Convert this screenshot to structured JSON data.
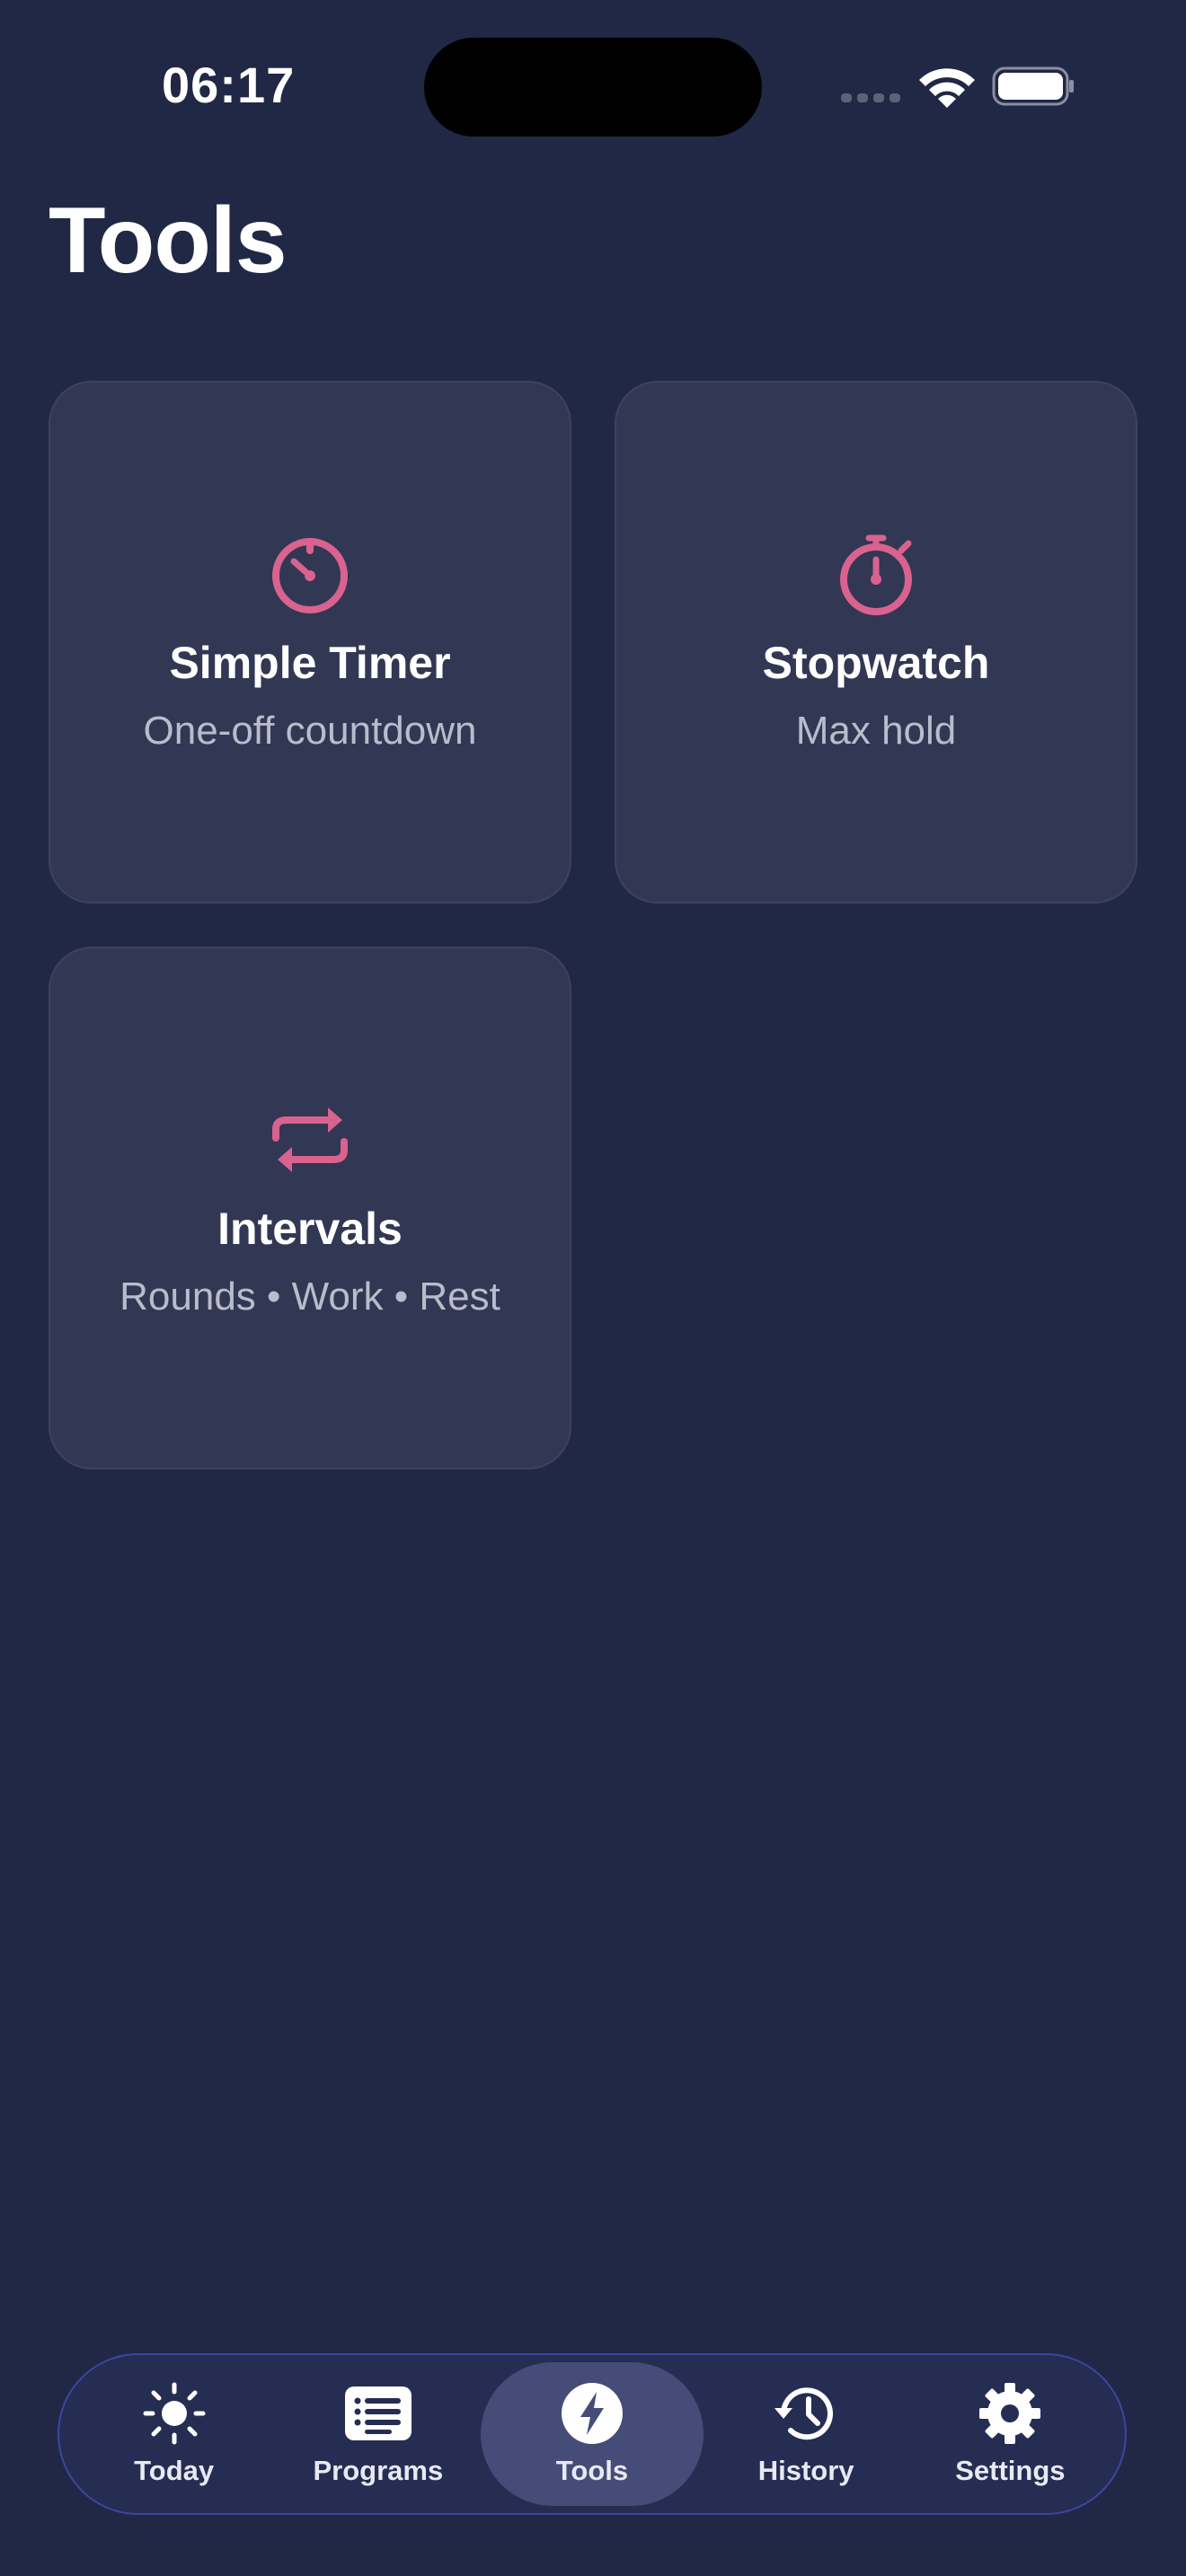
{
  "status_bar": {
    "time": "06:17"
  },
  "page": {
    "title": "Tools"
  },
  "accent_color": "#d9628f",
  "cards": [
    {
      "title": "Simple Timer",
      "subtitle": "One-off countdown",
      "icon": "timer-icon"
    },
    {
      "title": "Stopwatch",
      "subtitle": "Max hold",
      "icon": "stopwatch-icon"
    },
    {
      "title": "Intervals",
      "subtitle": "Rounds • Work • Rest",
      "icon": "repeat-icon"
    }
  ],
  "tabbar": {
    "items": [
      {
        "label": "Today",
        "icon": "sun-icon",
        "active": false
      },
      {
        "label": "Programs",
        "icon": "list-icon",
        "active": false
      },
      {
        "label": "Tools",
        "icon": "bolt-icon",
        "active": true
      },
      {
        "label": "History",
        "icon": "history-icon",
        "active": false
      },
      {
        "label": "Settings",
        "icon": "gear-icon",
        "active": false
      }
    ]
  }
}
